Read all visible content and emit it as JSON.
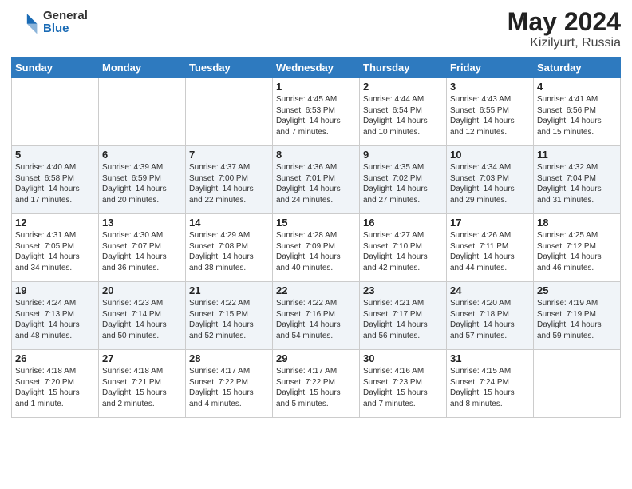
{
  "header": {
    "logo_general": "General",
    "logo_blue": "Blue",
    "month_title": "May 2024",
    "location": "Kizilyurt, Russia"
  },
  "weekdays": [
    "Sunday",
    "Monday",
    "Tuesday",
    "Wednesday",
    "Thursday",
    "Friday",
    "Saturday"
  ],
  "weeks": [
    [
      {
        "day": "",
        "text": ""
      },
      {
        "day": "",
        "text": ""
      },
      {
        "day": "",
        "text": ""
      },
      {
        "day": "1",
        "text": "Sunrise: 4:45 AM\nSunset: 6:53 PM\nDaylight: 14 hours\nand 7 minutes."
      },
      {
        "day": "2",
        "text": "Sunrise: 4:44 AM\nSunset: 6:54 PM\nDaylight: 14 hours\nand 10 minutes."
      },
      {
        "day": "3",
        "text": "Sunrise: 4:43 AM\nSunset: 6:55 PM\nDaylight: 14 hours\nand 12 minutes."
      },
      {
        "day": "4",
        "text": "Sunrise: 4:41 AM\nSunset: 6:56 PM\nDaylight: 14 hours\nand 15 minutes."
      }
    ],
    [
      {
        "day": "5",
        "text": "Sunrise: 4:40 AM\nSunset: 6:58 PM\nDaylight: 14 hours\nand 17 minutes."
      },
      {
        "day": "6",
        "text": "Sunrise: 4:39 AM\nSunset: 6:59 PM\nDaylight: 14 hours\nand 20 minutes."
      },
      {
        "day": "7",
        "text": "Sunrise: 4:37 AM\nSunset: 7:00 PM\nDaylight: 14 hours\nand 22 minutes."
      },
      {
        "day": "8",
        "text": "Sunrise: 4:36 AM\nSunset: 7:01 PM\nDaylight: 14 hours\nand 24 minutes."
      },
      {
        "day": "9",
        "text": "Sunrise: 4:35 AM\nSunset: 7:02 PM\nDaylight: 14 hours\nand 27 minutes."
      },
      {
        "day": "10",
        "text": "Sunrise: 4:34 AM\nSunset: 7:03 PM\nDaylight: 14 hours\nand 29 minutes."
      },
      {
        "day": "11",
        "text": "Sunrise: 4:32 AM\nSunset: 7:04 PM\nDaylight: 14 hours\nand 31 minutes."
      }
    ],
    [
      {
        "day": "12",
        "text": "Sunrise: 4:31 AM\nSunset: 7:05 PM\nDaylight: 14 hours\nand 34 minutes."
      },
      {
        "day": "13",
        "text": "Sunrise: 4:30 AM\nSunset: 7:07 PM\nDaylight: 14 hours\nand 36 minutes."
      },
      {
        "day": "14",
        "text": "Sunrise: 4:29 AM\nSunset: 7:08 PM\nDaylight: 14 hours\nand 38 minutes."
      },
      {
        "day": "15",
        "text": "Sunrise: 4:28 AM\nSunset: 7:09 PM\nDaylight: 14 hours\nand 40 minutes."
      },
      {
        "day": "16",
        "text": "Sunrise: 4:27 AM\nSunset: 7:10 PM\nDaylight: 14 hours\nand 42 minutes."
      },
      {
        "day": "17",
        "text": "Sunrise: 4:26 AM\nSunset: 7:11 PM\nDaylight: 14 hours\nand 44 minutes."
      },
      {
        "day": "18",
        "text": "Sunrise: 4:25 AM\nSunset: 7:12 PM\nDaylight: 14 hours\nand 46 minutes."
      }
    ],
    [
      {
        "day": "19",
        "text": "Sunrise: 4:24 AM\nSunset: 7:13 PM\nDaylight: 14 hours\nand 48 minutes."
      },
      {
        "day": "20",
        "text": "Sunrise: 4:23 AM\nSunset: 7:14 PM\nDaylight: 14 hours\nand 50 minutes."
      },
      {
        "day": "21",
        "text": "Sunrise: 4:22 AM\nSunset: 7:15 PM\nDaylight: 14 hours\nand 52 minutes."
      },
      {
        "day": "22",
        "text": "Sunrise: 4:22 AM\nSunset: 7:16 PM\nDaylight: 14 hours\nand 54 minutes."
      },
      {
        "day": "23",
        "text": "Sunrise: 4:21 AM\nSunset: 7:17 PM\nDaylight: 14 hours\nand 56 minutes."
      },
      {
        "day": "24",
        "text": "Sunrise: 4:20 AM\nSunset: 7:18 PM\nDaylight: 14 hours\nand 57 minutes."
      },
      {
        "day": "25",
        "text": "Sunrise: 4:19 AM\nSunset: 7:19 PM\nDaylight: 14 hours\nand 59 minutes."
      }
    ],
    [
      {
        "day": "26",
        "text": "Sunrise: 4:18 AM\nSunset: 7:20 PM\nDaylight: 15 hours\nand 1 minute."
      },
      {
        "day": "27",
        "text": "Sunrise: 4:18 AM\nSunset: 7:21 PM\nDaylight: 15 hours\nand 2 minutes."
      },
      {
        "day": "28",
        "text": "Sunrise: 4:17 AM\nSunset: 7:22 PM\nDaylight: 15 hours\nand 4 minutes."
      },
      {
        "day": "29",
        "text": "Sunrise: 4:17 AM\nSunset: 7:22 PM\nDaylight: 15 hours\nand 5 minutes."
      },
      {
        "day": "30",
        "text": "Sunrise: 4:16 AM\nSunset: 7:23 PM\nDaylight: 15 hours\nand 7 minutes."
      },
      {
        "day": "31",
        "text": "Sunrise: 4:15 AM\nSunset: 7:24 PM\nDaylight: 15 hours\nand 8 minutes."
      },
      {
        "day": "",
        "text": ""
      }
    ]
  ]
}
